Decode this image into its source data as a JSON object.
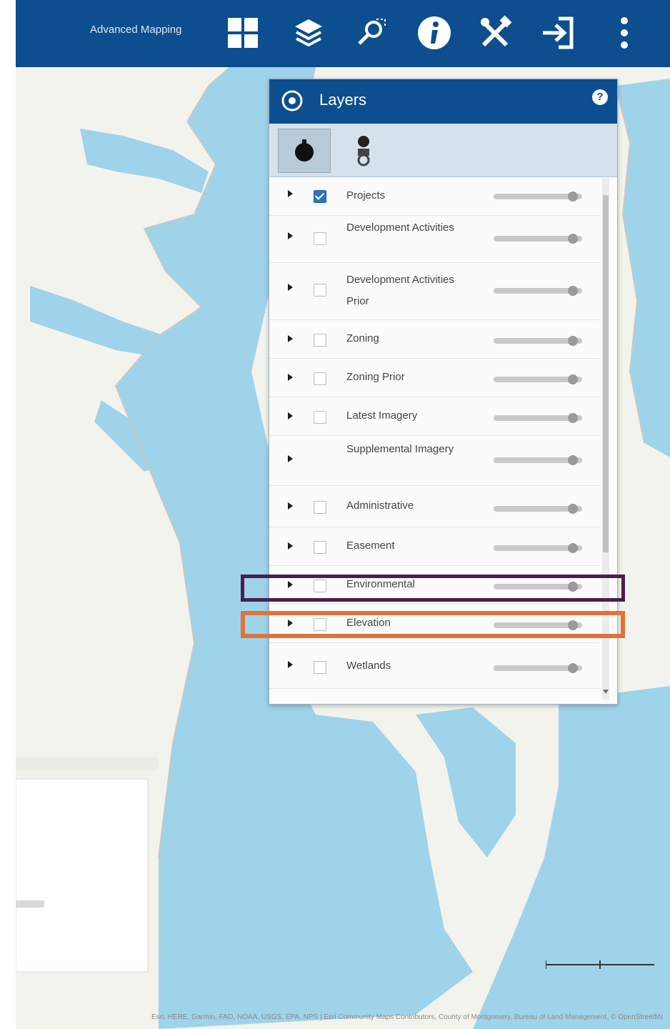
{
  "toolbar": {
    "title": "Advanced Mapping",
    "buttons": [
      {
        "icon": "grid-icon"
      },
      {
        "icon": "layers-icon"
      },
      {
        "icon": "search-map-icon"
      },
      {
        "icon": "info-icon"
      },
      {
        "icon": "tools-icon"
      },
      {
        "icon": "sign-in-icon"
      },
      {
        "icon": "more-vertical-icon"
      }
    ]
  },
  "layers_panel": {
    "title": "Layers",
    "help_label": "?",
    "tabs": [
      {
        "icon": "layer-list-icon",
        "active": true
      },
      {
        "icon": "legend-icon",
        "active": false
      }
    ],
    "layers": [
      {
        "name": "Projects",
        "checked": true,
        "opacity": 0.9
      },
      {
        "name": "Development Activities",
        "checked": false,
        "opacity": 0.9
      },
      {
        "name": "Development Activities Prior",
        "checked": false,
        "opacity": 0.9
      },
      {
        "name": "Zoning",
        "checked": false,
        "opacity": 0.9
      },
      {
        "name": "Zoning Prior",
        "checked": false,
        "opacity": 0.9
      },
      {
        "name": "Latest Imagery",
        "checked": false,
        "opacity": 0.9
      },
      {
        "name": "Supplemental Imagery",
        "checked": null,
        "opacity": 0.9
      },
      {
        "name": "Administrative",
        "checked": false,
        "opacity": 0.9
      },
      {
        "name": "Easement",
        "checked": false,
        "opacity": 0.9
      },
      {
        "name": "Environmental",
        "checked": false,
        "opacity": 0.9
      },
      {
        "name": "Elevation",
        "checked": false,
        "opacity": 0.9
      },
      {
        "name": "Wetlands",
        "checked": false,
        "opacity": 0.9
      }
    ]
  },
  "highlights": {
    "environmental": "#4a1f4f",
    "elevation": "#e0733a"
  },
  "colors": {
    "toolbar": "#0c4e8e",
    "water": "#9fd3ea",
    "land": "#f3f3ee"
  },
  "map": {
    "attribution": "Esri, HERE, Garmin, FAO, NOAA, USGS, EPA, NPS | Esri Community Maps Contributors, County of Montgomery, Bureau of Land Management, © OpenStreetMap, Microsoft, Esri, TomTom | Powered by Esri"
  }
}
